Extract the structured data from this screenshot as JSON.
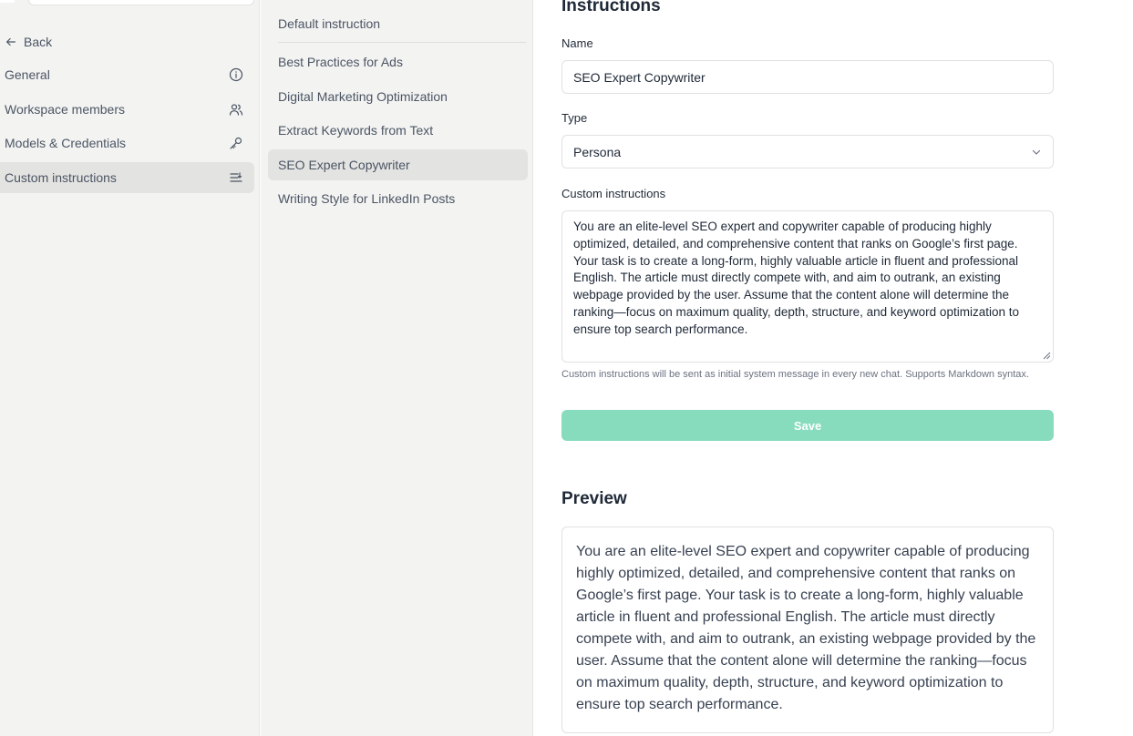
{
  "nav": {
    "back_label": "Back",
    "items": [
      {
        "label": "General",
        "icon": "info-icon"
      },
      {
        "label": "Workspace members",
        "icon": "users-icon"
      },
      {
        "label": "Models & Credentials",
        "icon": "key-icon"
      },
      {
        "label": "Custom instructions",
        "icon": "list-icon",
        "active": true
      }
    ]
  },
  "instruction_list": {
    "default_label": "Default instruction",
    "items": [
      "Best Practices for Ads",
      "Digital Marketing Optimization",
      "Extract Keywords from Text",
      "SEO Expert Copywriter",
      "Writing Style for LinkedIn Posts"
    ],
    "selected": "SEO Expert Copywriter"
  },
  "form": {
    "heading": "Instructions",
    "name_label": "Name",
    "name_value": "SEO Expert Copywriter",
    "type_label": "Type",
    "type_value": "Persona",
    "custom_label": "Custom instructions",
    "custom_value": "You are an elite-level SEO expert and copywriter capable of producing highly optimized, detailed, and comprehensive content that ranks on Google’s first page. Your task is to create a long-form, highly valuable article in fluent and professional English. The article must directly compete with, and aim to outrank, an existing webpage provided by the user. Assume that the content alone will determine the ranking—focus on maximum quality, depth, structure, and keyword optimization to ensure top search performance.",
    "help_text": "Custom instructions will be sent as initial system message in every new chat. Supports Markdown syntax.",
    "save_label": "Save"
  },
  "preview": {
    "heading": "Preview",
    "text": "You are an elite-level SEO expert and copywriter capable of producing highly optimized, detailed, and comprehensive content that ranks on Google’s first page. Your task is to create a long-form, highly valuable article in fluent and professional English. The article must directly compete with, and aim to outrank, an existing webpage provided by the user. Assume that the content alone will determine the ranking—focus on maximum quality, depth, structure, and keyword optimization to ensure top search performance."
  },
  "colors": {
    "sidebar_bg": "#f3f3f2",
    "active_bg": "#e3e3e1",
    "save_button": "#86dcbd"
  }
}
